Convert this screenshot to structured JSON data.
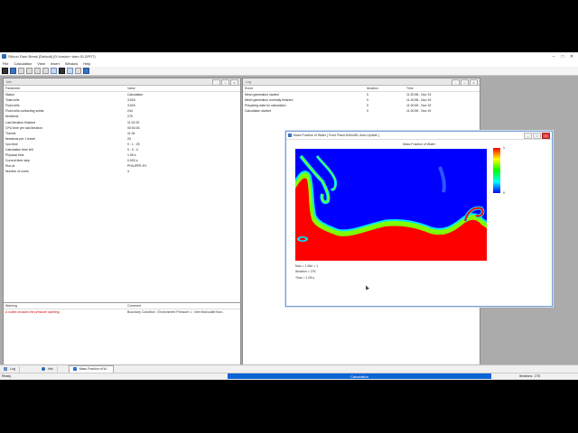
{
  "window": {
    "title": "Silicon Dam Break [Default] (D:\\boston~dam.SLDPRT)"
  },
  "menu": [
    "File",
    "Calculation",
    "View",
    "Insert",
    "Window",
    "Help"
  ],
  "info_panel": {
    "name": "Info",
    "columns": [
      "Parameter",
      "Value"
    ],
    "rows": [
      [
        "Status",
        "Calculation"
      ],
      [
        "Total cells",
        "3,520"
      ],
      [
        "Fluid cells",
        "3,520"
      ],
      [
        "Fluid cells contacting solids",
        "244"
      ],
      [
        "Iterations",
        "276"
      ],
      [
        "Last iteration finished",
        "11:22:20"
      ],
      [
        "CPU time per last iteration",
        "00:00:00"
      ],
      [
        "Travels",
        "11.04"
      ],
      [
        "Iterations per 1 travel",
        "25"
      ],
      [
        "Cpu time",
        "0 : 1 : 29"
      ],
      [
        "Calculation time left",
        "0 : 0 : 4"
      ],
      [
        "Physical time",
        "1.05 s"
      ],
      [
        "Current time step",
        "0.003 s"
      ],
      [
        "Run at",
        "PHILIPPE-PC"
      ],
      [
        "Number of cores",
        "4"
      ]
    ]
  },
  "warning_panel": {
    "columns": [
      "Warning",
      "Comment"
    ],
    "rows": [
      [
        "A vortex crosses the pressure opening",
        "Boundary Condition : Environment Pressure 1 : Inlet flow/outlet flow..."
      ]
    ]
  },
  "log_panel": {
    "name": "Log",
    "columns": [
      "Event",
      "Iteration",
      "Time"
    ],
    "rows": [
      [
        "Mesh generation started",
        "0",
        "11:20:55 , Nov 19"
      ],
      [
        "Mesh generation normally finished",
        "0",
        "11:20:55 , Nov 19"
      ],
      [
        "Preparing data for calculation",
        "0",
        "11:20:59 , Nov 19"
      ],
      [
        "Calculation started",
        "0",
        "11:20:59 , Nov 19"
      ]
    ]
  },
  "chart_window": {
    "title": "Mass Fraction of Water [ Front Plane;840x480; Auto Update ]",
    "plot_title": "Mass Fraction of Water",
    "legend_max": "1",
    "legend_min": "0",
    "status_lines": [
      "Max = 1  Min = 1",
      "Iteration = 276",
      "Time = 1.05 s"
    ],
    "colors": {
      "water": "#ff0000",
      "air": "#0000ff",
      "interface_outer": "#00e5ff",
      "interface_inner": "#7fff00"
    }
  },
  "taskbar": {
    "items": [
      "Log",
      "Info",
      "Mass Fraction of W..."
    ]
  },
  "statusbar": {
    "ready": "Ready",
    "progress_label": "Calculation",
    "iterations": "Iterations : 276"
  }
}
